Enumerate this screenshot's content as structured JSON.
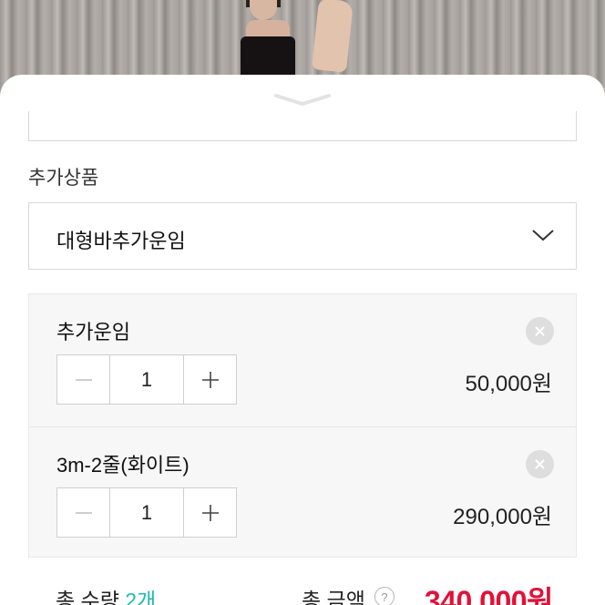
{
  "options": {
    "section_label": "추가상품",
    "select_value": "대형바추가운임"
  },
  "items": [
    {
      "name": "추가운임",
      "quantity": "1",
      "price": "50,000원"
    },
    {
      "name": "3m-2줄(화이트)",
      "quantity": "1",
      "price": "290,000원"
    }
  ],
  "summary": {
    "qty_label": "총 수량 ",
    "qty_value": "2개",
    "total_label": "총 금액",
    "help": "?",
    "total_price": "340,000원"
  },
  "colors": {
    "accent_teal": "#1bbdb0",
    "price_red": "#e0123a"
  },
  "icons": {
    "handle": "chevron-down-icon",
    "select": "chevron-down-icon",
    "remove": "close-icon",
    "minus": "minus-icon",
    "plus": "plus-icon",
    "help": "help-icon"
  }
}
